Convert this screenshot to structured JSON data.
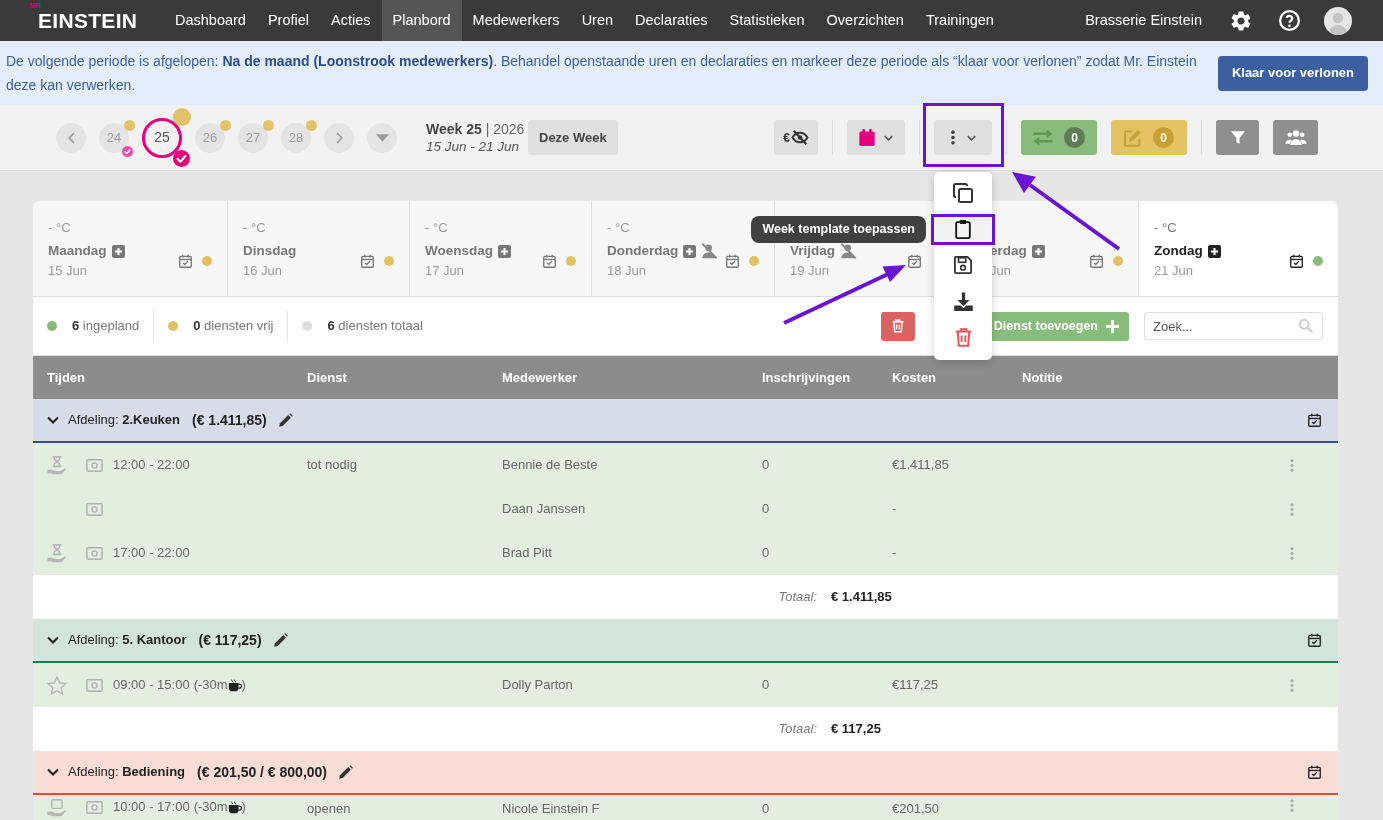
{
  "nav": {
    "logo_small": "MR",
    "logo": "EINSTEIN",
    "items": [
      {
        "label": "Dashboard",
        "selected": false
      },
      {
        "label": "Profiel",
        "selected": false
      },
      {
        "label": "Acties",
        "selected": false
      },
      {
        "label": "Planbord",
        "selected": true
      },
      {
        "label": "Medewerkers",
        "selected": false
      },
      {
        "label": "Uren",
        "selected": false
      },
      {
        "label": "Declaraties",
        "selected": false
      },
      {
        "label": "Statistieken",
        "selected": false
      },
      {
        "label": "Overzichten",
        "selected": false
      },
      {
        "label": "Trainingen",
        "selected": false
      }
    ],
    "company": "Brasserie Einstein"
  },
  "banner": {
    "message": "De volgende periode is afgelopen: **Na de maand (Loonstrook medewerkers)**. Behandel openstaande uren en declaraties en markeer deze periode als “klaar voor verlonen” zodat Mr. Einstein deze kan verwerken.",
    "button": "Klaar voor verlonen"
  },
  "week_picker": {
    "weeks": [
      {
        "label": "24",
        "selected": false,
        "pending": true,
        "checked": true
      },
      {
        "label": "25",
        "selected": true,
        "pending": true,
        "checked": true
      },
      {
        "label": "26",
        "selected": false,
        "pending": true,
        "checked": false
      },
      {
        "label": "27",
        "selected": false,
        "pending": true,
        "checked": false
      },
      {
        "label": "28",
        "selected": false,
        "pending": true,
        "checked": false
      }
    ],
    "title": "**Week 25** | 2026",
    "range": "15 Jun - 21 Jun",
    "current_week_button": "Deze Week"
  },
  "toolbar": {
    "currency_label": "€",
    "more_highlighted": true,
    "swap_count": "0",
    "edit_count": "0"
  },
  "menu": {
    "items": [
      {
        "kind": "copy",
        "selected": false
      },
      {
        "kind": "paste",
        "selected": true,
        "tooltip": "Week template toepassen"
      },
      {
        "kind": "save",
        "selected": false
      },
      {
        "kind": "download",
        "selected": false
      },
      {
        "kind": "delete",
        "selected": false
      }
    ]
  },
  "days": [
    {
      "temperature": "- °C",
      "name": "Maandag",
      "date": "15 Jun",
      "can_add": true,
      "unavailable": false,
      "color": "#e2c064",
      "selected": false
    },
    {
      "temperature": "- °C",
      "name": "Dinsdag",
      "date": "16 Jun",
      "can_add": false,
      "unavailable": false,
      "color": "#e2c064",
      "selected": false
    },
    {
      "temperature": "- °C",
      "name": "Woensdag",
      "date": "17 Jun",
      "can_add": true,
      "unavailable": false,
      "color": "#e2c064",
      "selected": false
    },
    {
      "temperature": "- °C",
      "name": "Donderdag",
      "date": "18 Jun",
      "can_add": true,
      "unavailable": true,
      "color": "#e2c064",
      "selected": false
    },
    {
      "name": "Vrijdag",
      "date": "19 Jun",
      "can_add": false,
      "unavailable": true,
      "selected": false
    },
    {
      "name": "erdag",
      "date": "Jun",
      "can_add": true,
      "unavailable": false,
      "color": "#e2c064",
      "selected": false
    },
    {
      "temperature": "- °C",
      "name": "Zondag",
      "date": "21 Jun",
      "can_add": true,
      "unavailable": false,
      "color": "#88bb7a",
      "selected": true
    }
  ],
  "summary": [
    {
      "text": "**6** ingepland",
      "color": "#88bb7a"
    },
    {
      "text": "**0** diensten vrij",
      "color": "#e2c064"
    },
    {
      "text": "**6** diensten totaal",
      "color": "#dddddd"
    }
  ],
  "add_button": "Dienst toevoegen",
  "search": {
    "placeholder": "Zoek..."
  },
  "table": {
    "columns": [
      "Tijden",
      "Dienst",
      "Medewerker",
      "Inschrijvingen",
      "Kosten",
      "Notitie"
    ]
  },
  "groups": [
    {
      "label": "Afdeling: **2.Keuken**",
      "total": "(€ 1.411,85)",
      "color": "#3b4f8f",
      "rows": [
        {
          "kind": "hourglass",
          "time": "12:00 - 22:00",
          "service": "tot nodig",
          "employee": "Bennie de Beste",
          "signups": "0",
          "cost": "€1.411,85"
        },
        {
          "kind": "none",
          "employee": "Daan Janssen",
          "signups": "0",
          "cost": "-"
        },
        {
          "kind": "hourglass",
          "time": "17:00 - 22:00",
          "employee": "Brad Pitt",
          "signups": "0",
          "cost": "-"
        }
      ],
      "footer": {
        "label": "Totaal:",
        "amount": "€ 1.411,85"
      }
    },
    {
      "label": "Afdeling: **5. Kantoor**",
      "total": "(€ 117,25)",
      "color": "#1e7a50",
      "rows": [
        {
          "kind": "star",
          "time": "09:00 - 15:00",
          "break": {
            "text": "(-30m",
            "close": ")"
          },
          "employee": "Dolly Parton",
          "signups": "0",
          "cost": "€117,25"
        }
      ],
      "footer": {
        "label": "Totaal:",
        "amount": "€ 117,25"
      }
    },
    {
      "label": "Afdeling: **Bediening**",
      "total": "(€ 201,50 / € 800,00)",
      "color": "#d9532b",
      "rows": [
        {
          "kind": "box",
          "time": "10:00 - 17:00",
          "break": {
            "text": "(-30m",
            "close": ")"
          },
          "service": "openen",
          "employee": "Nicole Einstein F",
          "signups": "0",
          "cost": "€201,50"
        }
      ]
    }
  ]
}
